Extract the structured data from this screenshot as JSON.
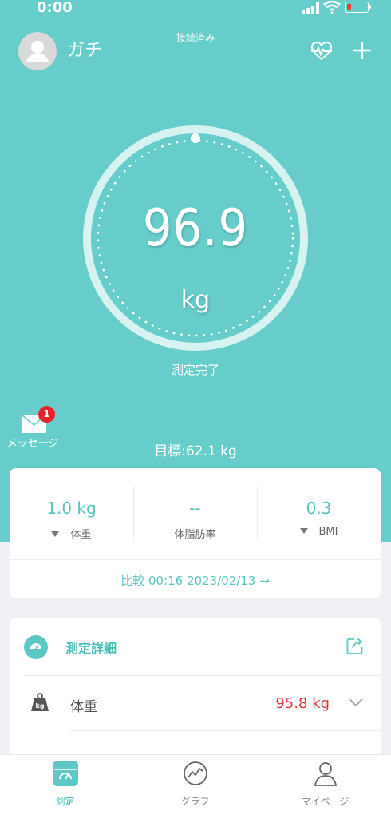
{
  "status_bar": {
    "time": "0:00"
  },
  "header": {
    "connection_status": "接続済み",
    "username": "ガチ"
  },
  "measurement": {
    "weight": "96.9",
    "unit": "kg",
    "status": "測定完了",
    "goal": "目標:62.1 kg"
  },
  "message": {
    "label": "メッセージ",
    "badge": "1"
  },
  "stats": [
    {
      "value": "1.0 kg",
      "label": "体重",
      "trend": "down"
    },
    {
      "value": "--",
      "label": "体脂肪率",
      "trend": "none"
    },
    {
      "value": "0.3",
      "label": "BMI",
      "trend": "down"
    }
  ],
  "compare": {
    "text": "比較 00:16 2023/02/13 →"
  },
  "detail": {
    "title": "測定詳細",
    "rows": [
      {
        "label": "体重",
        "value": "95.8 kg"
      }
    ]
  },
  "tabs": [
    {
      "label": "測定",
      "active": true
    },
    {
      "label": "グラフ",
      "active": false
    },
    {
      "label": "マイページ",
      "active": false
    }
  ],
  "colors": {
    "accent": "#66cdca",
    "value_red": "#e0383e",
    "badge_red": "#e52429"
  }
}
